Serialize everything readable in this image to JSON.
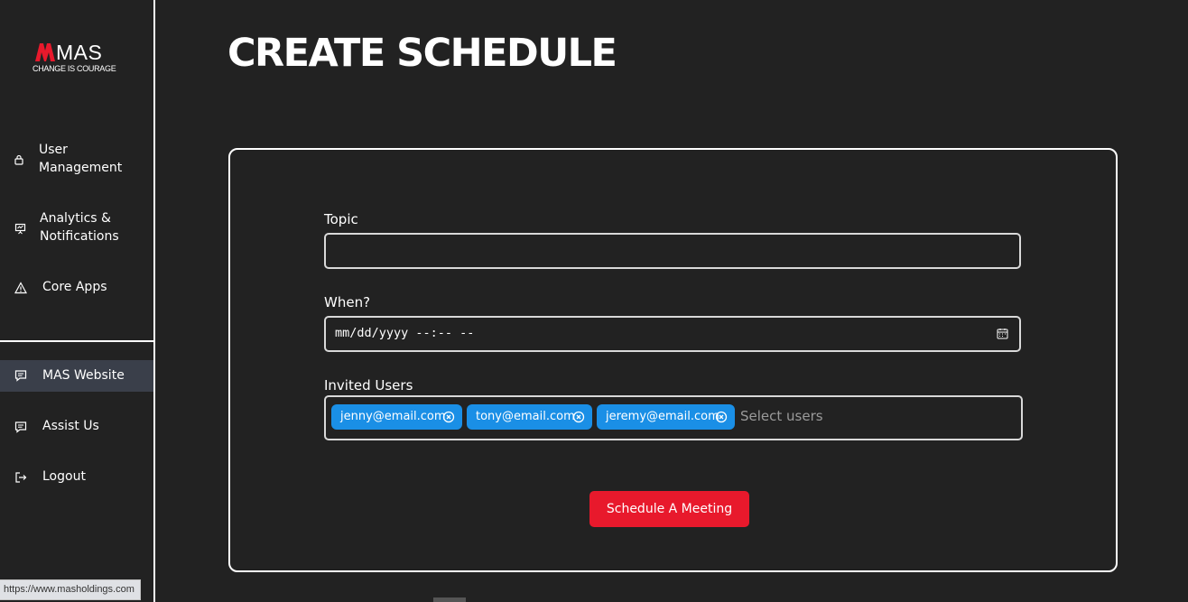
{
  "brand": {
    "name": "MAS",
    "tagline": "CHANGE IS COURAGE"
  },
  "sidebar": {
    "items": [
      {
        "label": "User\nManagement",
        "icon": "lock-icon"
      },
      {
        "label": "Analytics &\nNotifications",
        "icon": "presentation-chart-icon"
      },
      {
        "label": "Core Apps",
        "icon": "warning-triangle-icon"
      },
      {
        "label": "MAS Website",
        "icon": "chat-icon",
        "active": true
      },
      {
        "label": "Assist Us",
        "icon": "chat-icon"
      },
      {
        "label": "Logout",
        "icon": "logout-icon"
      }
    ]
  },
  "page": {
    "title": "CREATE SCHEDULE"
  },
  "form": {
    "topic_label": "Topic",
    "topic_value": "",
    "when_label": "When?",
    "when_placeholder": "mm/dd/yyyy --:-- --",
    "invited_label": "Invited Users",
    "invited_users": [
      "jenny@email.com",
      "tony@email.com",
      "jeremy@email.com"
    ],
    "invited_placeholder": "Select users",
    "submit_label": "Schedule A Meeting"
  },
  "status_bar": {
    "url": "https://www.masholdings.com"
  },
  "colors": {
    "background": "#222222",
    "chip": "#1a8fe6",
    "primary_button": "#e8192c",
    "active_nav": "#3a3f4a"
  }
}
